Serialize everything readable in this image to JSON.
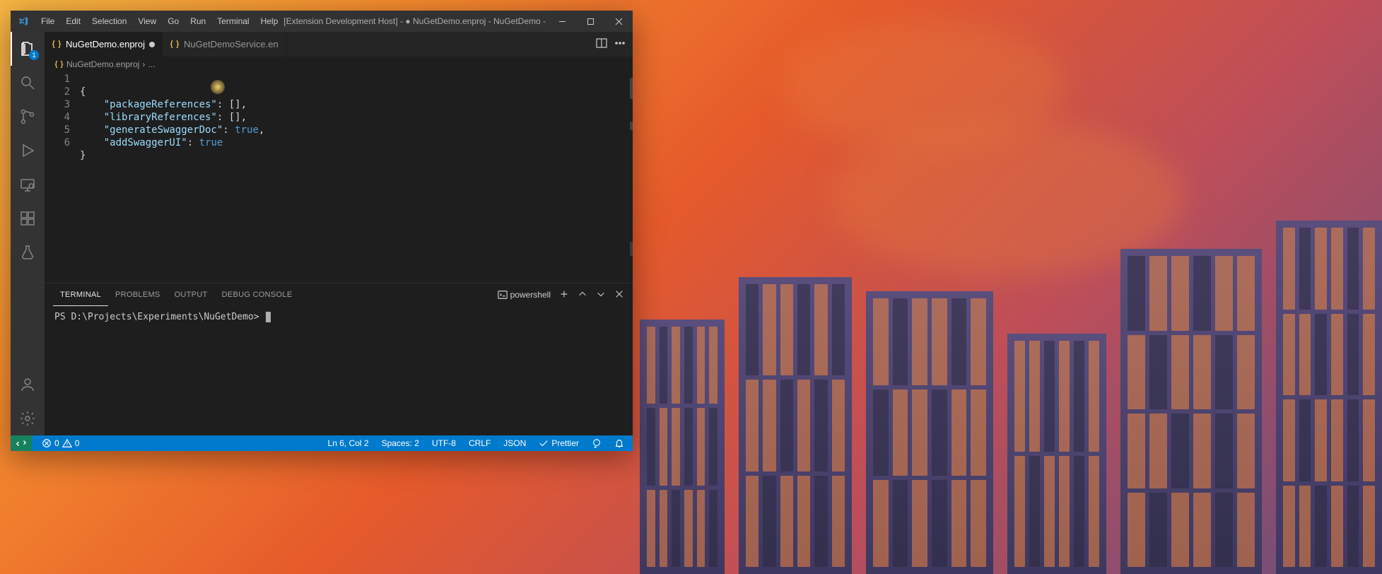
{
  "title": "[Extension Development Host] - ● NuGetDemo.enproj - NuGetDemo - Visual Studio Code",
  "menu": [
    "File",
    "Edit",
    "Selection",
    "View",
    "Go",
    "Run",
    "Terminal",
    "Help"
  ],
  "activity_badge": "1",
  "tabs": [
    {
      "label": "NuGetDemo.enproj",
      "active": true,
      "dirty": true
    },
    {
      "label": "NuGetDemoService.en",
      "active": false,
      "dirty": false
    }
  ],
  "breadcrumb": {
    "file": "NuGetDemo.enproj",
    "tail": "..."
  },
  "code": {
    "lines": [
      "1",
      "2",
      "3",
      "4",
      "5",
      "6"
    ],
    "l1_open": "{",
    "l2_key": "\"packageReferences\"",
    "l2_colon": ": ",
    "l2_open": "[",
    "l2_close": "],",
    "l3_key": "\"libraryReferences\"",
    "l3_rest": ": [],",
    "l4_key": "\"generateSwaggerDoc\"",
    "l4_colon": ": ",
    "l4_val": "true",
    "l4_comma": ",",
    "l5_key": "\"addSwaggerUI\"",
    "l5_colon": ": ",
    "l5_val": "true",
    "l6_close": "}"
  },
  "panel_tabs": [
    "TERMINAL",
    "PROBLEMS",
    "OUTPUT",
    "DEBUG CONSOLE"
  ],
  "terminal_kind": "powershell",
  "terminal_prompt": "PS D:\\Projects\\Experiments\\NuGetDemo> ",
  "status": {
    "errors": "0",
    "warnings": "0",
    "cursor": "Ln 6, Col 2",
    "spaces": "Spaces: 2",
    "encoding": "UTF-8",
    "eol": "CRLF",
    "language": "JSON",
    "formatter": "Prettier"
  }
}
